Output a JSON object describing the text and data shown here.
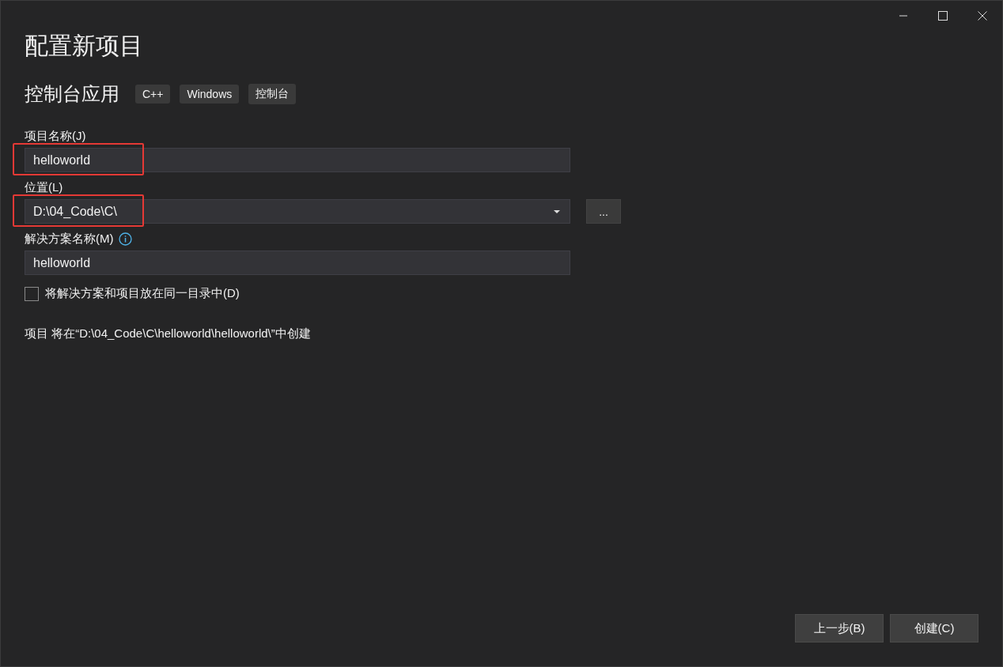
{
  "window": {
    "title": "配置新项目"
  },
  "template": {
    "name": "控制台应用",
    "tags": [
      "C++",
      "Windows",
      "控制台"
    ]
  },
  "fields": [
    {
      "kind": "text",
      "label": "项目名称(J)",
      "value": "helloworld",
      "highlighted": true,
      "info": false
    },
    {
      "kind": "dropdown",
      "label": "位置(L)",
      "value": "D:\\04_Code\\C\\",
      "highlighted": true,
      "info": false,
      "browse_button": "..."
    },
    {
      "kind": "text",
      "label": "解决方案名称(M)",
      "value": "helloworld",
      "highlighted": false,
      "info": true
    }
  ],
  "same_directory": {
    "label": "将解决方案和项目放在同一目录中(D)",
    "checked": false
  },
  "summary": "项目 将在“D:\\04_Code\\C\\helloworld\\helloworld\\”中创建",
  "buttons": [
    "上一步(B)",
    "创建(C)"
  ]
}
